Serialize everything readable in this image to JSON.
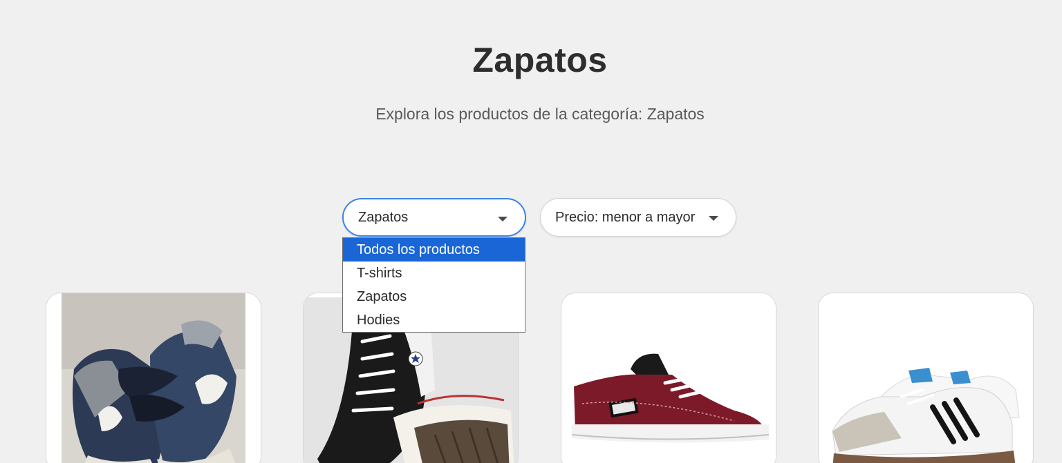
{
  "header": {
    "title": "Zapatos",
    "subtitle": "Explora los productos de la categoría: Zapatos"
  },
  "filters": {
    "category": {
      "selected": "Zapatos",
      "options": [
        "Todos los productos",
        "T-shirts",
        "Zapatos",
        "Hodies"
      ],
      "highlighted": "Todos los productos"
    },
    "sort": {
      "selected": "Precio: menor a mayor"
    }
  },
  "products": [
    {
      "image": "adidas-campus-dark-navy-sneakers"
    },
    {
      "image": "converse-chuck-taylor-black-high-top"
    },
    {
      "image": "vans-half-cab-burgundy"
    },
    {
      "image": "adidas-samba-white-gum"
    }
  ],
  "colors": {
    "background": "#f0f0f0",
    "accent_border": "#3b82e8",
    "dropdown_highlight": "#1a66d6"
  }
}
